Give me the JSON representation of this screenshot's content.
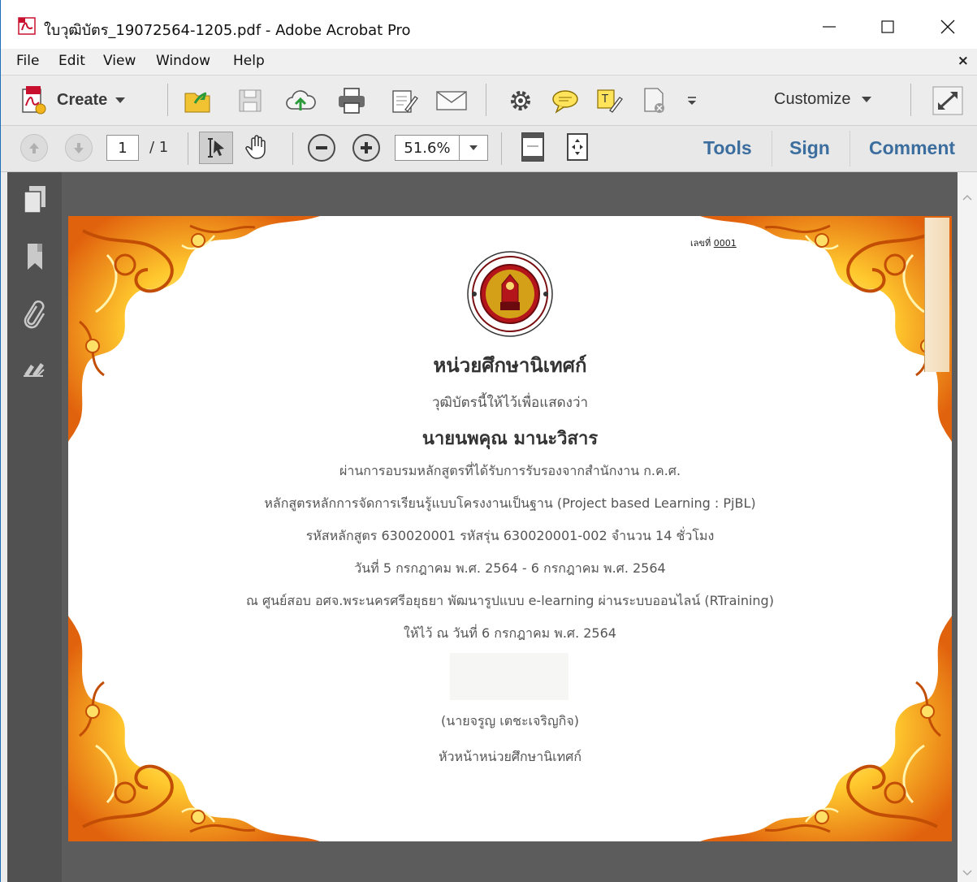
{
  "window": {
    "title": "ใบวุฒิบัตร_19072564-1205.pdf - Adobe Acrobat Pro"
  },
  "menubar": {
    "items": [
      "File",
      "Edit",
      "View",
      "Window",
      "Help"
    ],
    "close_glyph": "×"
  },
  "toolbar1": {
    "create_label": "Create",
    "customize_label": "Customize",
    "icons": [
      "open-icon",
      "save-icon",
      "cloud-upload-icon",
      "print-icon",
      "edit-form-icon",
      "email-icon",
      "settings-icon",
      "comment-icon",
      "highlight-icon",
      "document-action-icon",
      "more-tools-icon"
    ]
  },
  "toolbar2": {
    "current_page": "1",
    "total_pages": "/ 1",
    "zoom": "51.6%",
    "tools_label": "Tools",
    "sign_label": "Sign",
    "comment_label": "Comment"
  },
  "certificate": {
    "number_label": "เลขที่",
    "number_value": "0001",
    "org": "หน่วยศึกษานิเทศก์",
    "intro": "วุฒิบัตรนี้ให้ไว้เพื่อแสดงว่า",
    "recipient": "นายนพคุณ มานะวิสาร",
    "line1": "ผ่านการอบรมหลักสูตรที่ได้รับการรับรองจากสำนักงาน ก.ค.ศ.",
    "line2": "หลักสูตรหลักการจัดการเรียนรู้แบบโครงงานเป็นฐาน (Project based Learning : PjBL)",
    "line3": "รหัสหลักสูตร 630020001 รหัสรุ่น 630020001-002 จำนวน 14 ชั่วโมง",
    "line4": "วันที่ 5 กรกฎาคม พ.ศ. 2564 - 6 กรกฎาคม พ.ศ. 2564",
    "line5": "ณ ศูนย์สอบ อศจ.พระนครศรีอยุธยา พัฒนารูปแบบ e-learning ผ่านระบบออนไลน์ (RTraining)",
    "line6": "ให้ไว้ ณ วันที่ 6 กรกฎาคม พ.ศ. 2564",
    "signer": "(นายจรูญ เตชะเจริญกิจ)",
    "signer_title": "หัวหน้าหน่วยศึกษานิเทศก์"
  },
  "colors": {
    "pane_link": "#3b6e9e",
    "frame_dark": "#e07a10",
    "frame_light": "#ffd84a"
  }
}
